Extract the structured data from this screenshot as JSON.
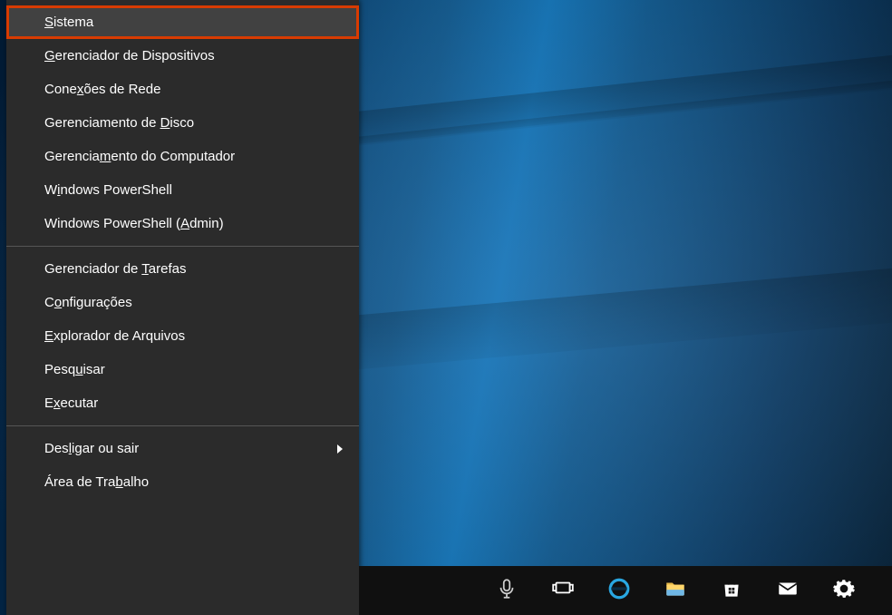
{
  "menu": {
    "sections": [
      {
        "items": [
          {
            "pre": "",
            "accel": "S",
            "post": "istema",
            "highlight": true,
            "hover": true
          },
          {
            "pre": "",
            "accel": "G",
            "post": "erenciador de Dispositivos"
          },
          {
            "pre": "Cone",
            "accel": "x",
            "post": "ões de Rede"
          },
          {
            "pre": "Gerenciamento de ",
            "accel": "D",
            "post": "isco"
          },
          {
            "pre": "Gerencia",
            "accel": "m",
            "post": "ento do Computador"
          },
          {
            "pre": "W",
            "accel": "i",
            "post": "ndows PowerShell"
          },
          {
            "pre": "Windows PowerShell (",
            "accel": "A",
            "post": "dmin)"
          }
        ]
      },
      {
        "items": [
          {
            "pre": "Gerenciador de ",
            "accel": "T",
            "post": "arefas"
          },
          {
            "pre": "C",
            "accel": "o",
            "post": "nfigurações"
          },
          {
            "pre": "",
            "accel": "E",
            "post": "xplorador de Arquivos"
          },
          {
            "pre": "Pesq",
            "accel": "u",
            "post": "isar"
          },
          {
            "pre": "E",
            "accel": "x",
            "post": "ecutar"
          }
        ]
      },
      {
        "items": [
          {
            "pre": "Des",
            "accel": "l",
            "post": "igar ou sair",
            "chevron": true
          },
          {
            "pre": "Área de Tra",
            "accel": "b",
            "post": "alho"
          }
        ]
      }
    ]
  },
  "taskbar": {
    "buttons": [
      {
        "name": "cortana-button",
        "icon": "microphone-icon"
      },
      {
        "name": "task-view-button",
        "icon": "taskview-icon"
      },
      {
        "name": "edge-button",
        "icon": "edge-icon"
      },
      {
        "name": "file-explorer-button",
        "icon": "folder-icon"
      },
      {
        "name": "store-button",
        "icon": "store-icon"
      },
      {
        "name": "mail-button",
        "icon": "mail-icon"
      },
      {
        "name": "settings-button",
        "icon": "gear-icon"
      }
    ]
  }
}
